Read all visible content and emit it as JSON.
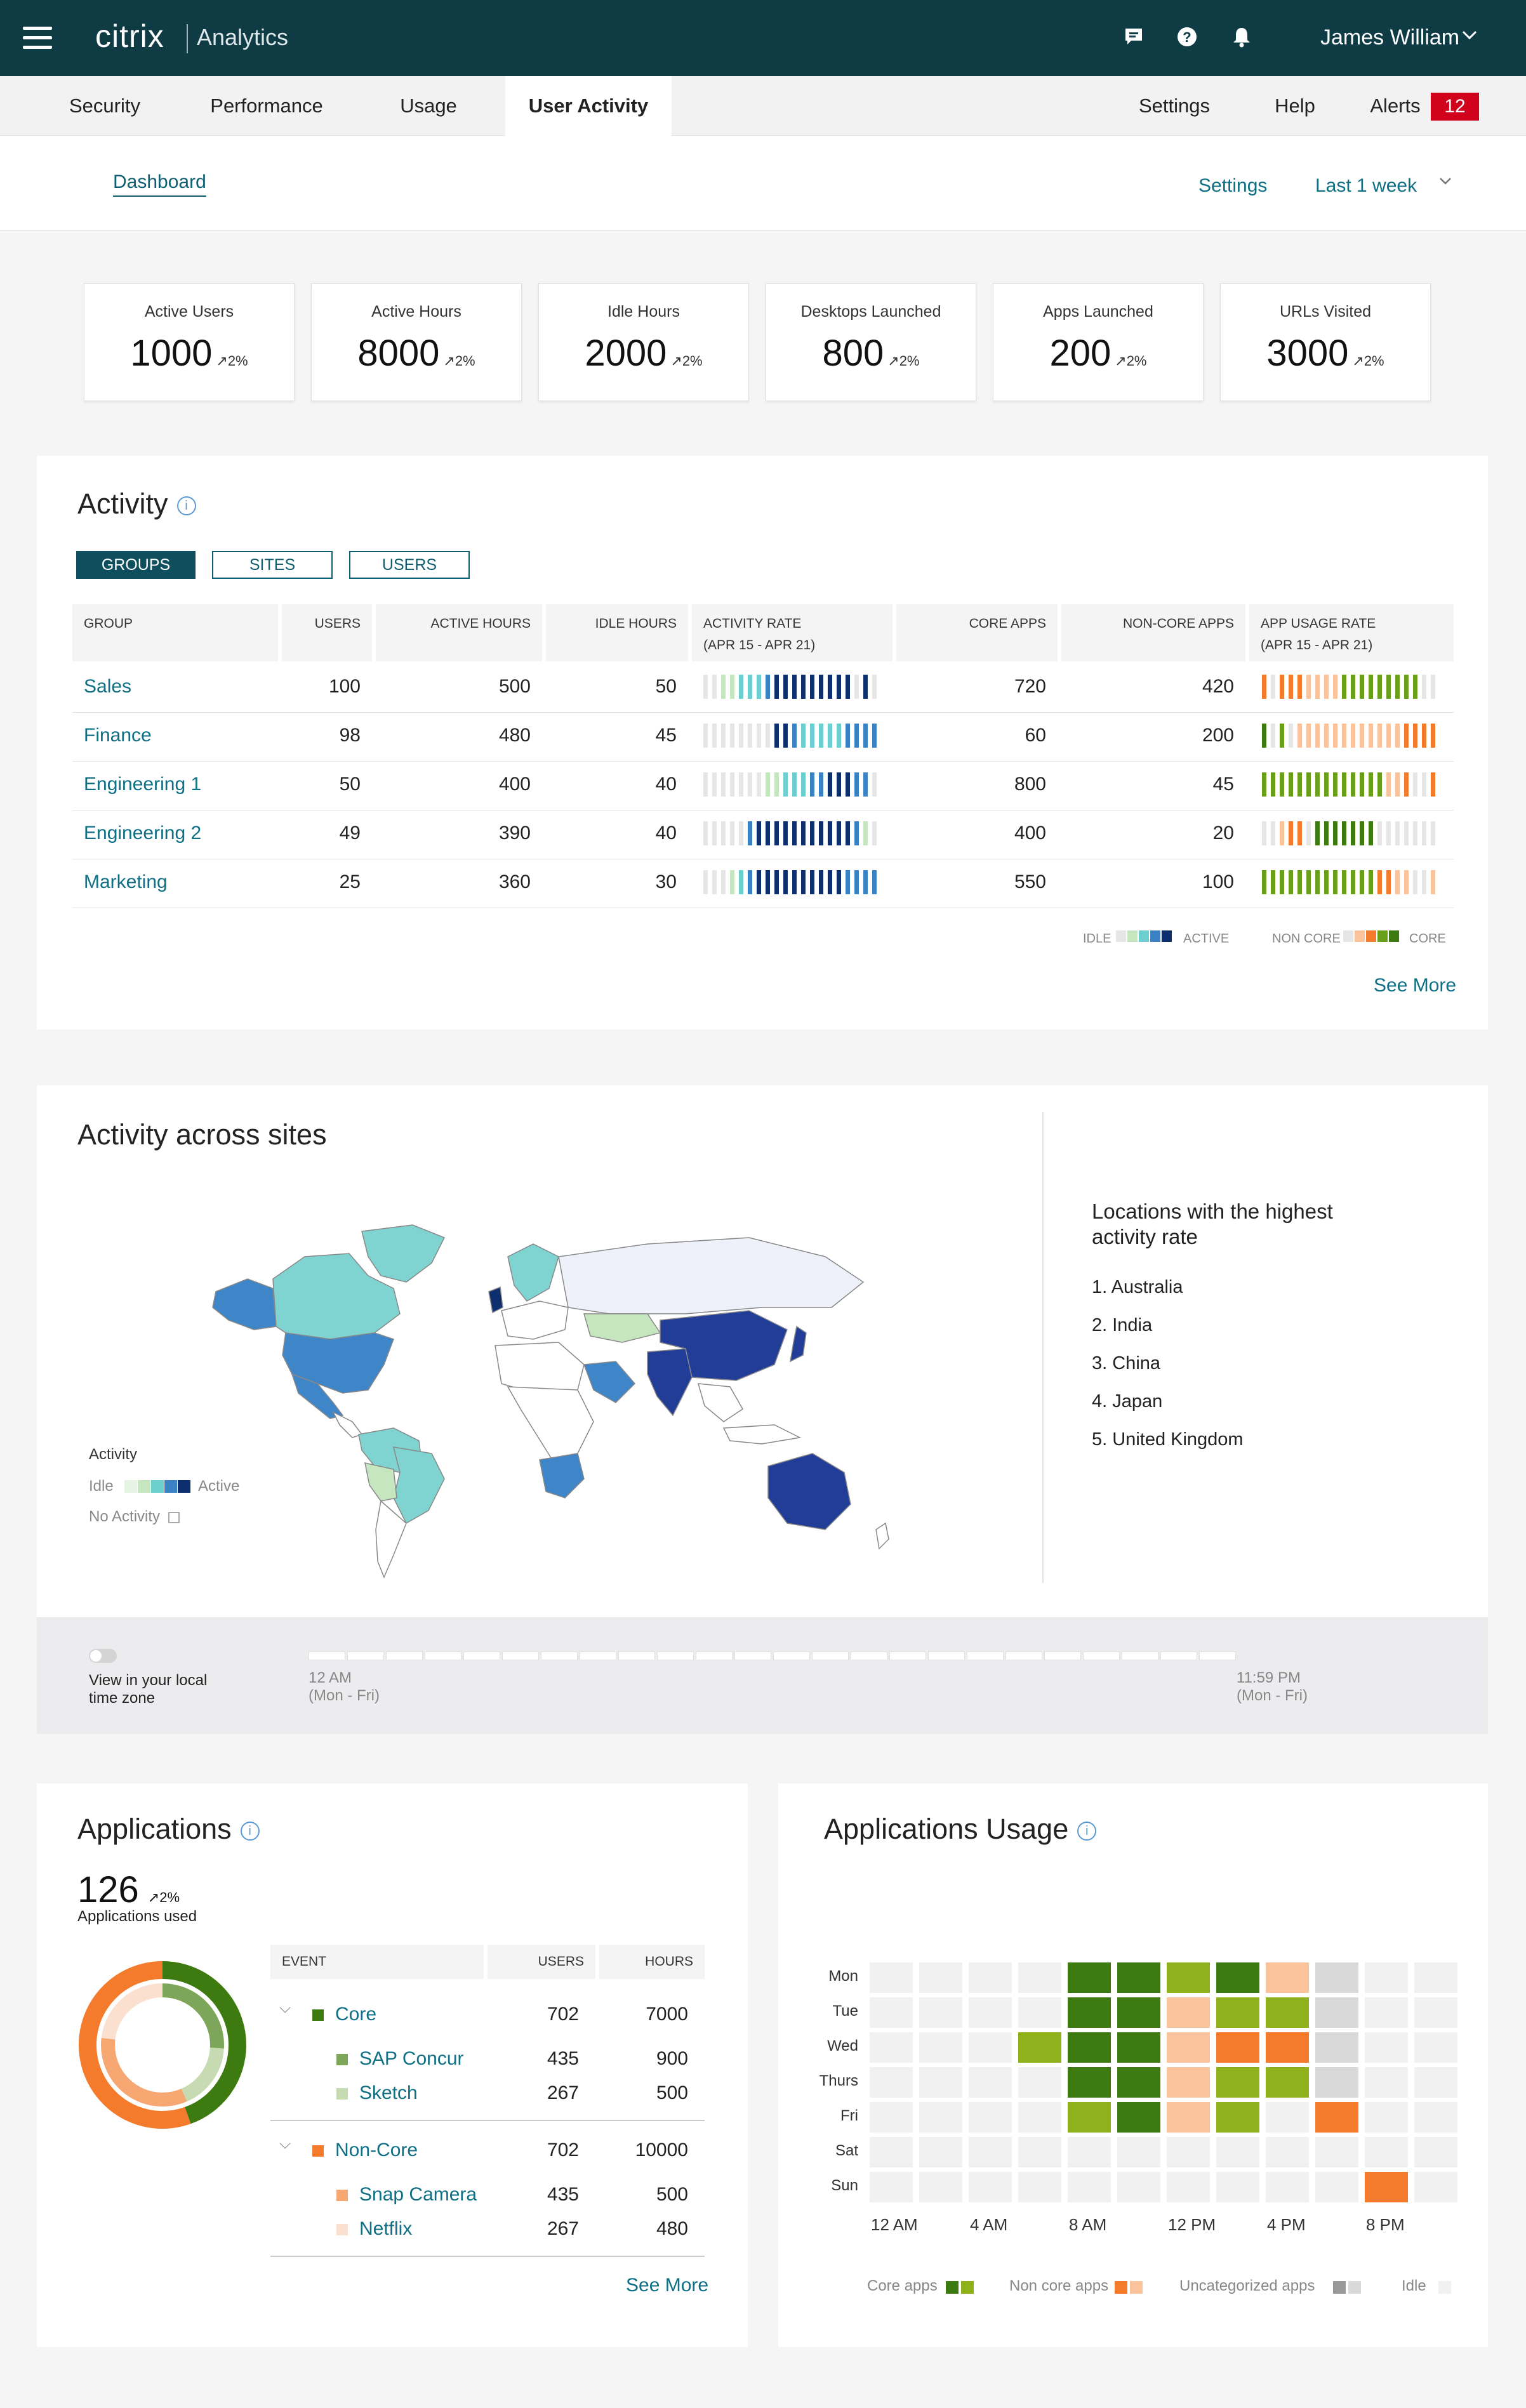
{
  "header": {
    "logo": "citrix",
    "product": "Analytics",
    "user_name": "James William"
  },
  "nav": {
    "tabs": [
      {
        "label": "Security"
      },
      {
        "label": "Performance"
      },
      {
        "label": "Usage"
      },
      {
        "label": "User Activity"
      }
    ],
    "settings": "Settings",
    "help": "Help",
    "alerts": "Alerts",
    "alerts_count": "12"
  },
  "subheader": {
    "dashboard": "Dashboard",
    "settings": "Settings",
    "range": "Last 1 week"
  },
  "kpis": [
    {
      "label": "Active Users",
      "value": "1000",
      "delta": "↗2%"
    },
    {
      "label": "Active Hours",
      "value": "8000",
      "delta": "↗2%"
    },
    {
      "label": "Idle Hours",
      "value": "2000",
      "delta": "↗2%"
    },
    {
      "label": "Desktops Launched",
      "value": "800",
      "delta": "↗2%"
    },
    {
      "label": "Apps Launched",
      "value": "200",
      "delta": "↗2%"
    },
    {
      "label": "URLs Visited",
      "value": "3000",
      "delta": "↗2%"
    }
  ],
  "activity": {
    "title": "Activity",
    "tabs": [
      "GROUPS",
      "SITES",
      "USERS"
    ],
    "columns": [
      "GROUP",
      "USERS",
      "ACTIVE HOURS",
      "IDLE HOURS",
      "ACTIVITY RATE",
      "(APR 15 - APR 21)",
      "CORE APPS",
      "NON-CORE APPS",
      "APP USAGE RATE",
      "(APR 15 - APR 21)"
    ],
    "rows": [
      {
        "group": "Sales",
        "users": "100",
        "active": "500",
        "idle": "50",
        "core": "720",
        "noncore": "420"
      },
      {
        "group": "Finance",
        "users": "98",
        "active": "480",
        "idle": "45",
        "core": "60",
        "noncore": "200"
      },
      {
        "group": "Engineering 1",
        "users": "50",
        "active": "400",
        "idle": "40",
        "core": "800",
        "noncore": "45"
      },
      {
        "group": "Engineering 2",
        "users": "49",
        "active": "390",
        "idle": "40",
        "core": "400",
        "noncore": "20"
      },
      {
        "group": "Marketing",
        "users": "25",
        "active": "360",
        "idle": "30",
        "core": "550",
        "noncore": "100"
      }
    ],
    "legend": {
      "idle": "IDLE",
      "active": "ACTIVE",
      "noncore": "NON CORE",
      "core": "CORE"
    },
    "see_more": "See More",
    "colors": {
      "idle": "#e6e6e6",
      "light": "#c6e6bf",
      "teal": "#6ccfcf",
      "blue": "#3a82c4",
      "navy": "#0d2f6e",
      "orange": "#f47b2b",
      "peach": "#fbc39b",
      "green": "#6a9f1a",
      "darkgreen": "#3d7a10"
    }
  },
  "sites": {
    "title": "Activity across sites",
    "legend_title": "Activity",
    "legend_idle": "Idle",
    "legend_active": "Active",
    "legend_none": "No Activity",
    "top_title_1": "Locations with the highest",
    "top_title_2": "activity rate",
    "top_locations": [
      "1. Australia",
      "2. India",
      "3. China",
      "4. Japan",
      "5. United Kingdom"
    ],
    "toggle_label_1": "View in your local",
    "toggle_label_2": "time zone",
    "time_start": "12 AM",
    "time_start_sub": "(Mon - Fri)",
    "time_end": "11:59 PM",
    "time_end_sub": "(Mon - Fri)"
  },
  "applications": {
    "title": "Applications",
    "count": "126",
    "delta": "↗2%",
    "subtitle": "Applications used",
    "columns": [
      "EVENT",
      "USERS",
      "HOURS"
    ],
    "groups": [
      {
        "name": "Core",
        "users": "702",
        "hours": "7000",
        "children": [
          {
            "name": "SAP Concur",
            "users": "435",
            "hours": "900"
          },
          {
            "name": "Sketch",
            "users": "267",
            "hours": "500"
          }
        ]
      },
      {
        "name": "Non-Core",
        "users": "702",
        "hours": "10000",
        "children": [
          {
            "name": "Snap Camera",
            "users": "435",
            "hours": "500"
          },
          {
            "name": "Netflix",
            "users": "267",
            "hours": "480"
          }
        ]
      }
    ],
    "see_more": "See More"
  },
  "usage": {
    "title": "Applications Usage",
    "days": [
      "Mon",
      "Tue",
      "Wed",
      "Thurs",
      "Fri",
      "Sat",
      "Sun"
    ],
    "time_labels": [
      "12 AM",
      "4 AM",
      "8 AM",
      "12 PM",
      "4 PM",
      "8 PM"
    ],
    "legend": {
      "core": "Core apps",
      "noncore": "Non core apps",
      "uncat": "Uncategorized apps",
      "idle": "Idle"
    }
  }
}
